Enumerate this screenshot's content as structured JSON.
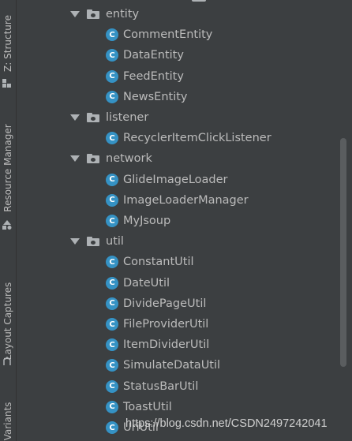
{
  "sidebar": {
    "tabs": [
      "Z: Structure",
      "Resource Manager",
      "Layout Captures",
      "Variants"
    ]
  },
  "tree": {
    "rows": [
      {
        "label": "entity",
        "kind": "folder"
      },
      {
        "label": "CommentEntity",
        "kind": "class"
      },
      {
        "label": "DataEntity",
        "kind": "class"
      },
      {
        "label": "FeedEntity",
        "kind": "class"
      },
      {
        "label": "NewsEntity",
        "kind": "class"
      },
      {
        "label": "listener",
        "kind": "folder"
      },
      {
        "label": "RecyclerItemClickListener",
        "kind": "class"
      },
      {
        "label": "network",
        "kind": "folder"
      },
      {
        "label": "GlideImageLoader",
        "kind": "class"
      },
      {
        "label": "ImageLoaderManager",
        "kind": "class"
      },
      {
        "label": "MyJsoup",
        "kind": "class"
      },
      {
        "label": "util",
        "kind": "folder"
      },
      {
        "label": "ConstantUtil",
        "kind": "class"
      },
      {
        "label": "DateUtil",
        "kind": "class"
      },
      {
        "label": "DividePageUtil",
        "kind": "class"
      },
      {
        "label": "FileProviderUtil",
        "kind": "class"
      },
      {
        "label": "ItemDividerUtil",
        "kind": "class"
      },
      {
        "label": "SimulateDataUtil",
        "kind": "class"
      },
      {
        "label": "StatusBarUtil",
        "kind": "class"
      },
      {
        "label": "ToastUtil",
        "kind": "class"
      },
      {
        "label": "UriUtil",
        "kind": "class"
      }
    ],
    "class_icon_letter": "C"
  },
  "watermark": "https://blog.csdn.net/CSDN2497242041",
  "colors": {
    "background": "#3c3f41",
    "text": "#bbbbbb",
    "class_icon": "#3592c4",
    "folder_icon": "#aeb2b5"
  }
}
